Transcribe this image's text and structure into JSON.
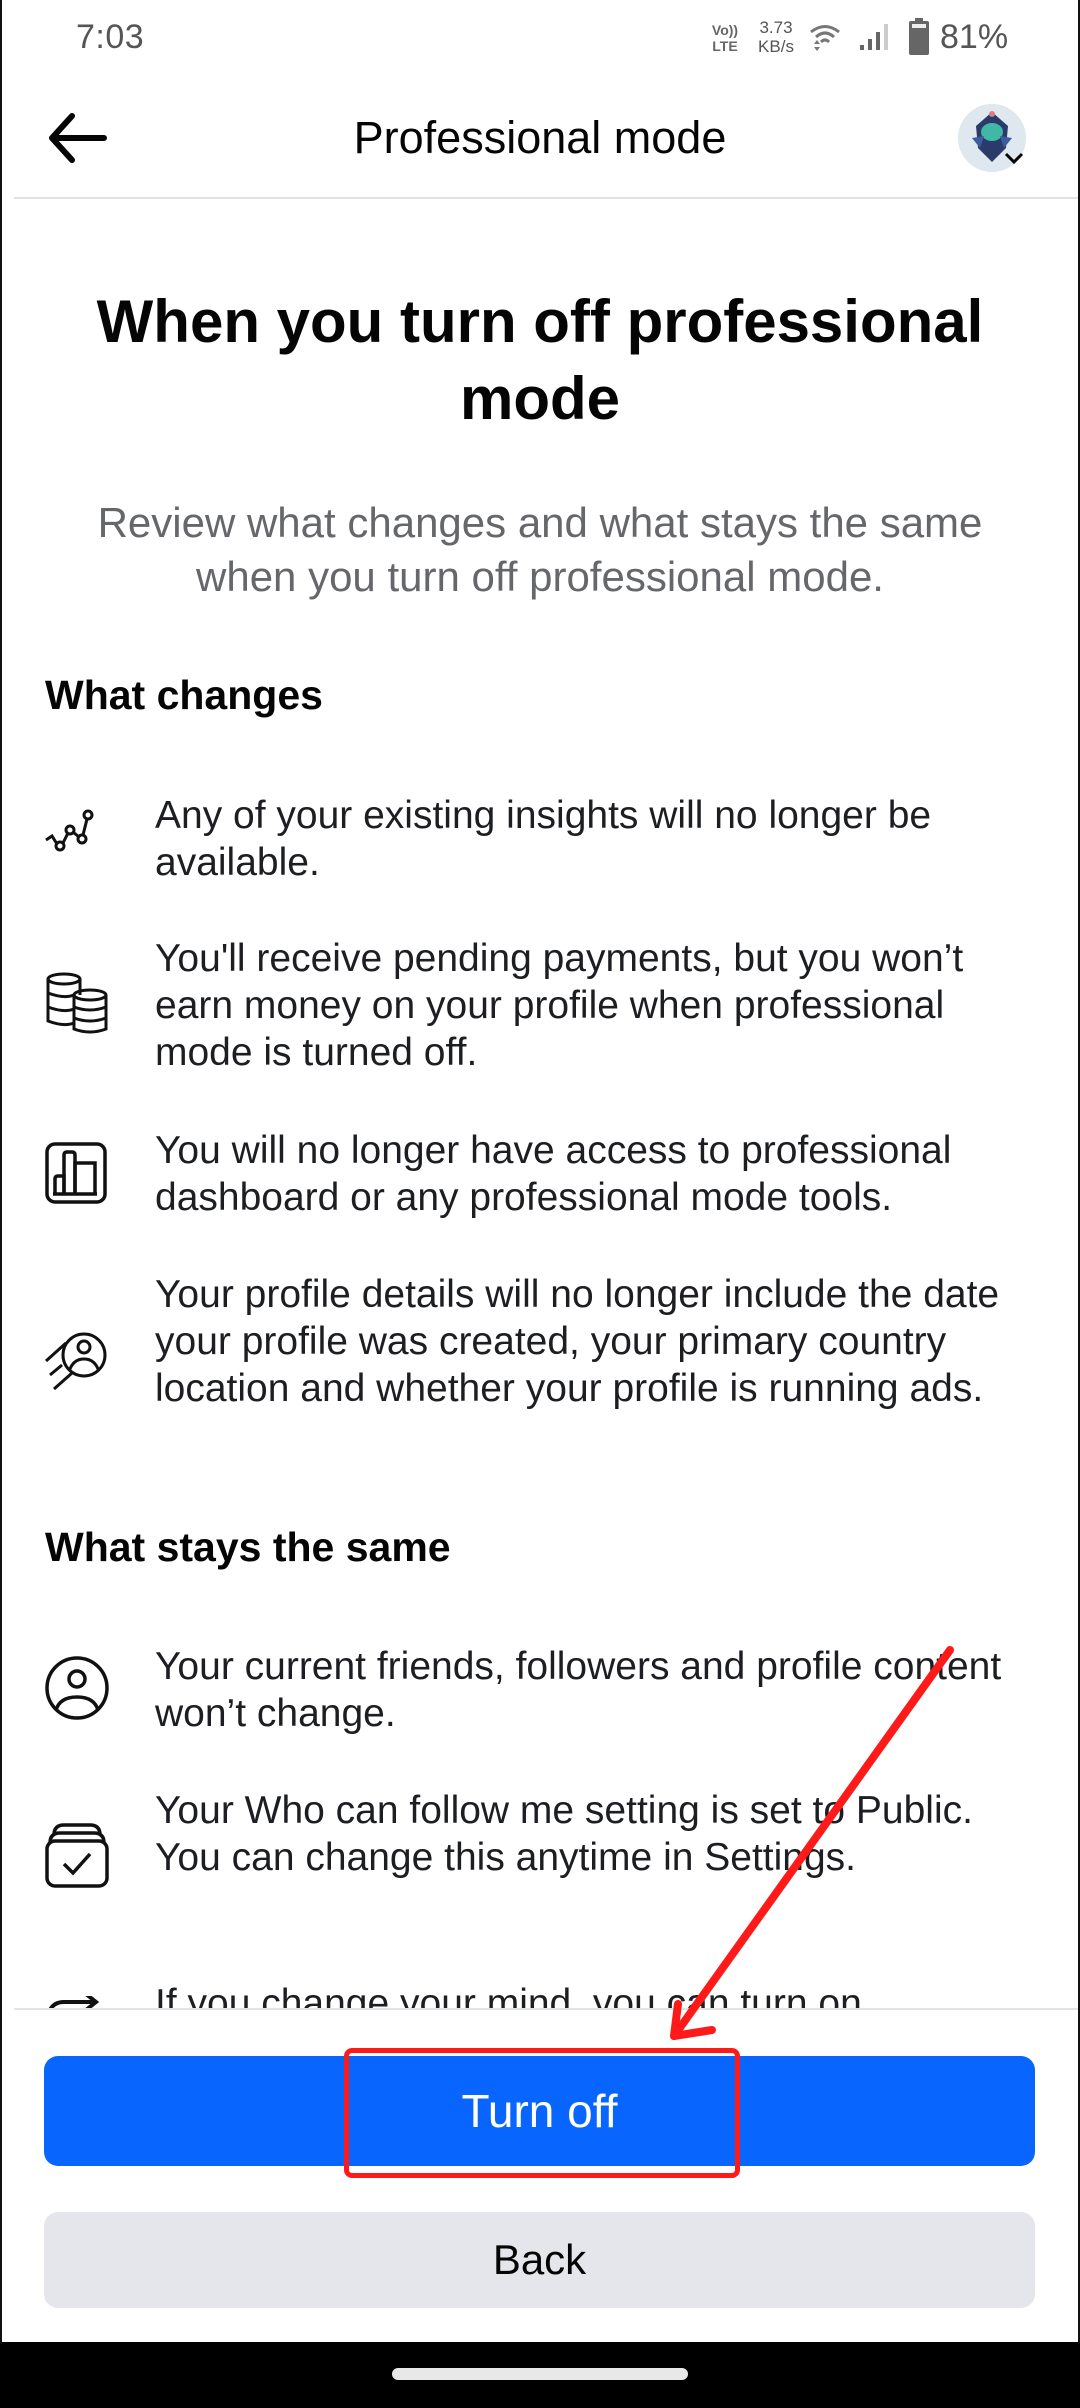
{
  "status_bar": {
    "time": "7:03",
    "volte_top": "Vo))",
    "volte_bottom": "LTE",
    "speed_value": "3.73",
    "speed_unit": "KB/s",
    "battery": "81%",
    "icons": [
      "volte-icon",
      "wifi-icon",
      "cellular-signal-icon",
      "battery-icon"
    ]
  },
  "header": {
    "title": "Professional mode",
    "back_icon": "arrow-left-icon",
    "avatar_icon": "profile-avatar",
    "avatar_menu_icon": "chevron-down-icon"
  },
  "intro": {
    "title": "When you turn off professional mode",
    "subtitle": "Review what changes and what stays the same when you turn off professional mode."
  },
  "what_changes": {
    "heading": "What changes",
    "items": [
      {
        "icon": "insights-line-chart-icon",
        "text": "Any of your existing insights will no longer be available."
      },
      {
        "icon": "coins-stack-icon",
        "text": "You'll receive pending payments, but you won’t earn money on your profile when professional mode is turned off."
      },
      {
        "icon": "dashboard-bar-chart-icon",
        "text": "You will no longer have access to professional dashboard or any professional mode tools."
      },
      {
        "icon": "profile-boost-icon",
        "text": "Your profile details will no longer include the date your profile was created, your primary country location and whether your profile is running ads."
      }
    ]
  },
  "what_stays": {
    "heading": "What stays the same",
    "items": [
      {
        "icon": "person-circle-icon",
        "text": "Your current friends, followers and profile content won’t change."
      },
      {
        "icon": "stacked-checkbox-icon",
        "text": "Your Who can follow me setting is set to Public. You can change this anytime in Settings."
      },
      {
        "icon": "switch-arrow-icon",
        "text": "If you change your mind, you can turn on"
      }
    ]
  },
  "actions": {
    "primary_label": "Turn off",
    "secondary_label": "Back"
  },
  "colors": {
    "primary": "#0866FF",
    "secondary": "#E4E6EB",
    "annotation": "#FF1A1A"
  }
}
